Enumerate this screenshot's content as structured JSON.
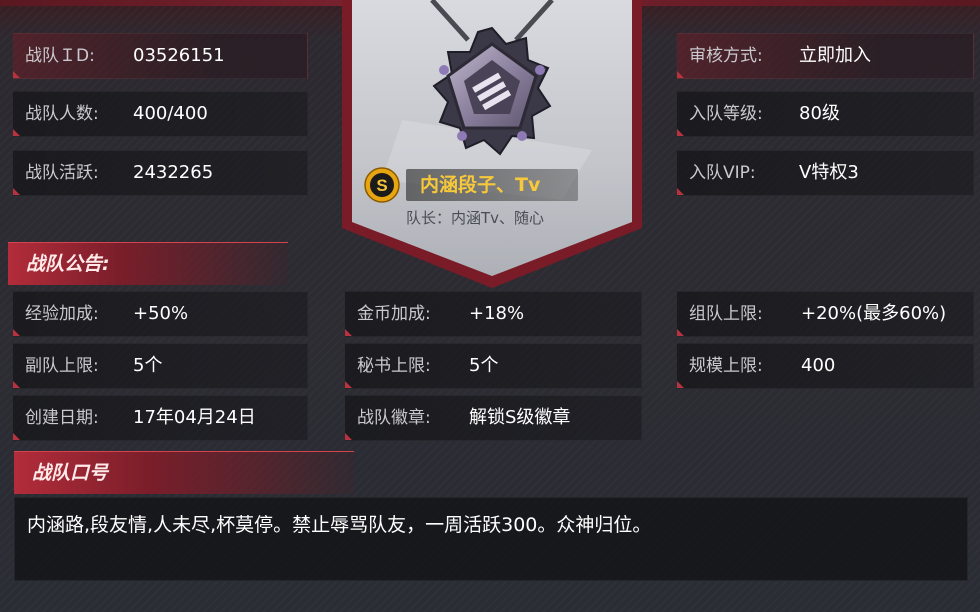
{
  "left_info": [
    {
      "label": "战队ＩD:",
      "value": "03526151"
    },
    {
      "label": "战队人数:",
      "value": "400/400"
    },
    {
      "label": "战队活跃:",
      "value": "2432265"
    }
  ],
  "right_info": [
    {
      "label": "审核方式:",
      "value": "立即加入"
    },
    {
      "label": "入队等级:",
      "value": "80级"
    },
    {
      "label": "入队VIP:",
      "value": "V特权3"
    }
  ],
  "emblem": {
    "grade_letter": "S",
    "team_name": "内涵段子、Tv",
    "captain_line": "队长：内涵Tv、随心"
  },
  "announcement": {
    "title": "战队公告:"
  },
  "bonuses": [
    {
      "label": "经验加成:",
      "value": "+50%"
    },
    {
      "label": "金币加成:",
      "value": "+18%"
    },
    {
      "label": "组队上限:",
      "value": "+20%(最多60%)"
    },
    {
      "label": "副队上限:",
      "value": "5个"
    },
    {
      "label": "秘书上限:",
      "value": "5个"
    },
    {
      "label": "规模上限:",
      "value": "400"
    },
    {
      "label": "创建日期:",
      "value": "17年04月24日"
    },
    {
      "label": "战队徽章:",
      "value": "解锁S级徽章"
    }
  ],
  "slogan": {
    "title": "战队口号",
    "text": "内涵路,段友情,人未尽,杯莫停。禁止辱骂队友，一周活跃300。众神归位。"
  },
  "colors": {
    "accent_red": "#b32c3a",
    "gold_text": "#f7c83a",
    "badge_gold": "#e8a512"
  }
}
